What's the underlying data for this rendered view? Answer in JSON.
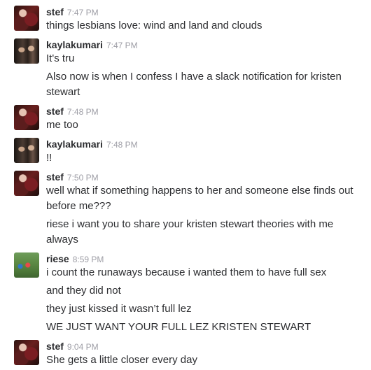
{
  "messages": [
    {
      "user": "stef",
      "avatar": "stef-avatar",
      "time": "7:47 PM",
      "lines": [
        "things lesbians love: wind and land and clouds"
      ]
    },
    {
      "user": "kaylakumari",
      "avatar": "kaylakumari-avatar",
      "time": "7:47 PM",
      "lines": [
        "It's tru",
        "Also now is when I confess I have a slack notification for kristen stewart"
      ]
    },
    {
      "user": "stef",
      "avatar": "stef-avatar",
      "time": "7:48 PM",
      "lines": [
        "me too"
      ]
    },
    {
      "user": "kaylakumari",
      "avatar": "kaylakumari-avatar",
      "time": "7:48 PM",
      "lines": [
        "!!"
      ]
    },
    {
      "user": "stef",
      "avatar": "stef-avatar",
      "time": "7:50 PM",
      "lines": [
        "well what if something happens to her and someone else finds out before me???",
        "riese i want you to share your kristen stewart theories with me always"
      ]
    },
    {
      "user": "riese",
      "avatar": "riese-avatar",
      "time": "8:59 PM",
      "lines": [
        "i count the runaways because i wanted them to have full sex",
        "and they did not",
        "they just kissed it wasn’t full lez",
        "WE JUST WANT YOUR FULL LEZ KRISTEN STEWART"
      ]
    },
    {
      "user": "stef",
      "avatar": "stef-avatar",
      "time": "9:04 PM",
      "lines": [
        "She gets a little closer every day"
      ]
    }
  ]
}
